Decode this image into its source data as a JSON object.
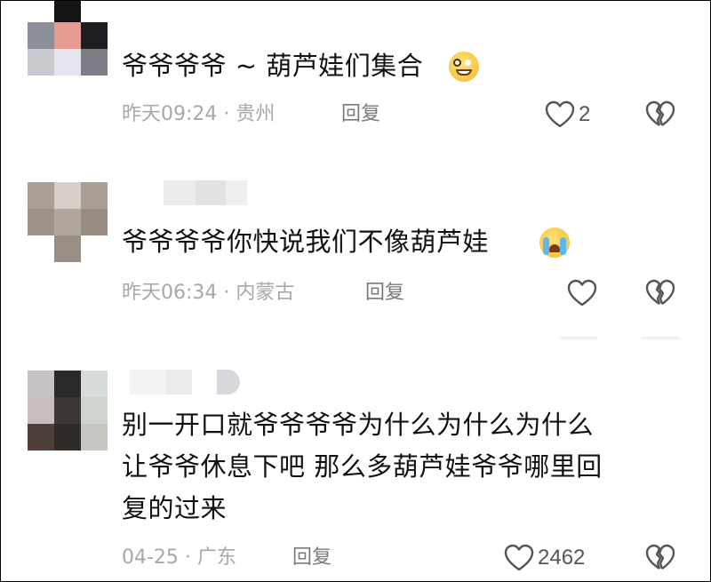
{
  "comments": [
    {
      "text_lines": [
        "爷爷爷爷 ~ 葫芦娃们集合"
      ],
      "emoji": "grinning-face-emoji",
      "time": "昨天09:24",
      "location": "贵州",
      "reply_label": "回复",
      "likes": "2"
    },
    {
      "text_lines": [
        "爷爷爷爷你快说我们不像葫芦娃"
      ],
      "emoji": "crying-face-emoji",
      "time": "昨天06:34",
      "location": "内蒙古",
      "reply_label": "回复",
      "likes": ""
    },
    {
      "text_lines": [
        "别一开口就爷爷爷爷为什么为什么为什么",
        "让爷爷休息下吧 那么多葫芦娃爷爷哪里回",
        "复的过来"
      ],
      "emoji": "",
      "time": "04-25",
      "location": "广东",
      "reply_label": "回复",
      "likes": "2462"
    }
  ],
  "meta_separator": "·",
  "icons": {
    "like": "heart-outline-icon",
    "dislike": "broken-heart-icon"
  },
  "colors": {
    "text": "#111111",
    "meta": "#a8a8a8",
    "reply": "#7a7a7a",
    "icon": "#555555"
  }
}
